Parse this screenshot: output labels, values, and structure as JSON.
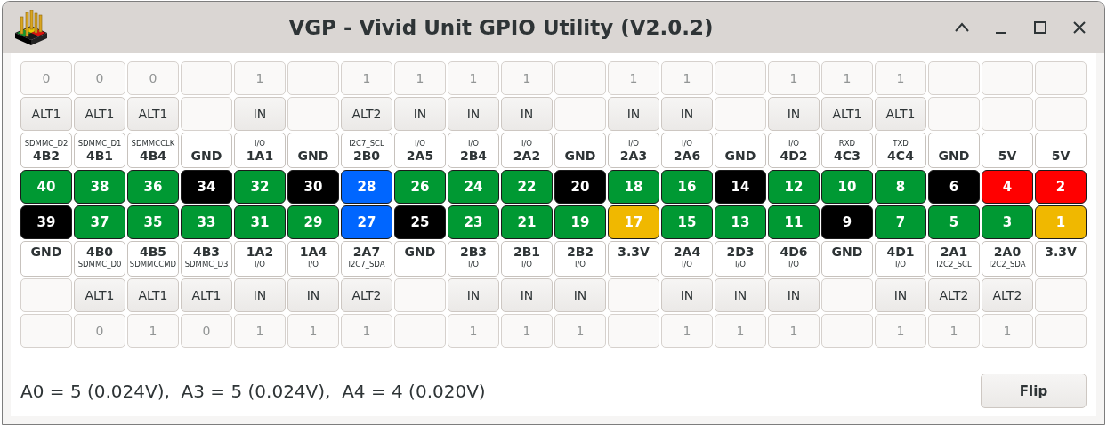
{
  "window": {
    "title": "VGP - Vivid Unit GPIO Utility (V2.0.2)"
  },
  "top_pins": [
    {
      "number": "40",
      "name": "4B2",
      "function": "SDMMC_D2",
      "mode": "ALT1",
      "value": "0",
      "color": "#009933"
    },
    {
      "number": "38",
      "name": "4B1",
      "function": "SDMMC_D1",
      "mode": "ALT1",
      "value": "0",
      "color": "#009933"
    },
    {
      "number": "36",
      "name": "4B4",
      "function": "SDMMCCLK",
      "mode": "ALT1",
      "value": "0",
      "color": "#009933"
    },
    {
      "number": "34",
      "name": "GND",
      "color": "#000000"
    },
    {
      "number": "32",
      "name": "1A1",
      "function": "I/O",
      "mode": "IN",
      "value": "1",
      "color": "#009933"
    },
    {
      "number": "30",
      "name": "GND",
      "color": "#000000"
    },
    {
      "number": "28",
      "name": "2B0",
      "function": "I2C7_SCL",
      "mode": "ALT2",
      "value": "1",
      "color": "#0066ff"
    },
    {
      "number": "26",
      "name": "2A5",
      "function": "I/O",
      "mode": "IN",
      "value": "1",
      "color": "#009933"
    },
    {
      "number": "24",
      "name": "2B4",
      "function": "I/O",
      "mode": "IN",
      "value": "1",
      "color": "#009933"
    },
    {
      "number": "22",
      "name": "2A2",
      "function": "I/O",
      "mode": "IN",
      "value": "1",
      "color": "#009933"
    },
    {
      "number": "20",
      "name": "GND",
      "color": "#000000"
    },
    {
      "number": "18",
      "name": "2A3",
      "function": "I/O",
      "mode": "IN",
      "value": "1",
      "color": "#009933"
    },
    {
      "number": "16",
      "name": "2A6",
      "function": "I/O",
      "mode": "IN",
      "value": "1",
      "color": "#009933"
    },
    {
      "number": "14",
      "name": "GND",
      "color": "#000000"
    },
    {
      "number": "12",
      "name": "4D2",
      "function": "I/O",
      "mode": "IN",
      "value": "1",
      "color": "#009933"
    },
    {
      "number": "10",
      "name": "4C3",
      "function": "RXD",
      "mode": "ALT1",
      "value": "1",
      "color": "#009933"
    },
    {
      "number": "8",
      "name": "4C4",
      "function": "TXD",
      "mode": "ALT1",
      "value": "1",
      "color": "#009933"
    },
    {
      "number": "6",
      "name": "GND",
      "color": "#000000"
    },
    {
      "number": "4",
      "name": "5V",
      "color": "#ff0000"
    },
    {
      "number": "2",
      "name": "5V",
      "color": "#ff0000"
    }
  ],
  "bottom_pins": [
    {
      "number": "39",
      "name": "GND",
      "color": "#000000"
    },
    {
      "number": "37",
      "name": "4B0",
      "function": "SDMMC_D0",
      "mode": "ALT1",
      "value": "0",
      "color": "#009933"
    },
    {
      "number": "35",
      "name": "4B5",
      "function": "SDMMCCMD",
      "mode": "ALT1",
      "value": "1",
      "color": "#009933"
    },
    {
      "number": "33",
      "name": "4B3",
      "function": "SDMMC_D3",
      "mode": "ALT1",
      "value": "0",
      "color": "#009933"
    },
    {
      "number": "31",
      "name": "1A2",
      "function": "I/O",
      "mode": "IN",
      "value": "1",
      "color": "#009933"
    },
    {
      "number": "29",
      "name": "1A4",
      "function": "I/O",
      "mode": "IN",
      "value": "1",
      "color": "#009933"
    },
    {
      "number": "27",
      "name": "2A7",
      "function": "I2C7_SDA",
      "mode": "ALT2",
      "value": "1",
      "color": "#0066ff"
    },
    {
      "number": "25",
      "name": "GND",
      "color": "#000000"
    },
    {
      "number": "23",
      "name": "2B3",
      "function": "I/O",
      "mode": "IN",
      "value": "1",
      "color": "#009933"
    },
    {
      "number": "21",
      "name": "2B1",
      "function": "I/O",
      "mode": "IN",
      "value": "1",
      "color": "#009933"
    },
    {
      "number": "19",
      "name": "2B2",
      "function": "I/O",
      "mode": "IN",
      "value": "1",
      "color": "#009933"
    },
    {
      "number": "17",
      "name": "3.3V",
      "color": "#f0b800"
    },
    {
      "number": "15",
      "name": "2A4",
      "function": "I/O",
      "mode": "IN",
      "value": "1",
      "color": "#009933"
    },
    {
      "number": "13",
      "name": "2D3",
      "function": "I/O",
      "mode": "IN",
      "value": "1",
      "color": "#009933"
    },
    {
      "number": "11",
      "name": "4D6",
      "function": "I/O",
      "mode": "IN",
      "value": "1",
      "color": "#009933"
    },
    {
      "number": "9",
      "name": "GND",
      "color": "#000000"
    },
    {
      "number": "7",
      "name": "4D1",
      "function": "I/O",
      "mode": "IN",
      "value": "1",
      "color": "#009933"
    },
    {
      "number": "5",
      "name": "2A1",
      "function": "I2C2_SCL",
      "mode": "ALT2",
      "value": "1",
      "color": "#009933"
    },
    {
      "number": "3",
      "name": "2A0",
      "function": "I2C2_SDA",
      "mode": "ALT2",
      "value": "1",
      "color": "#009933"
    },
    {
      "number": "1",
      "name": "3.3V",
      "color": "#f0b800"
    }
  ],
  "status_text": "A0 = 5 (0.024V),  A3 = 5 (0.024V),  A4 = 4 (0.020V)",
  "buttons": [
    {
      "label": "Flip"
    }
  ]
}
